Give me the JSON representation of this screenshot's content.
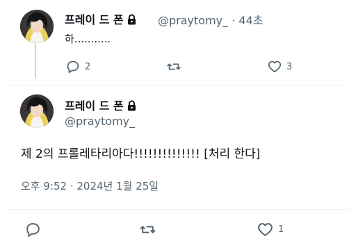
{
  "reply": {
    "display_name": "프레이 드 폰",
    "handle": "@praytomy_",
    "time": "44초",
    "text": "하...........",
    "actions": {
      "replies": "2",
      "retweets": "",
      "likes": "3"
    }
  },
  "main": {
    "display_name": "프레이 드 폰",
    "handle": "@praytomy_",
    "text": "제 2의 프롤레타리아다!!!!!!!!!!!!!! [처리 한다]",
    "timestamp": "오후 9:52 · 2024년 1월 25일",
    "actions": {
      "replies": "",
      "retweets": "",
      "likes": "1"
    }
  },
  "colors": {
    "text": "#0f1419",
    "muted": "#536471",
    "divider": "#eff3f4"
  }
}
